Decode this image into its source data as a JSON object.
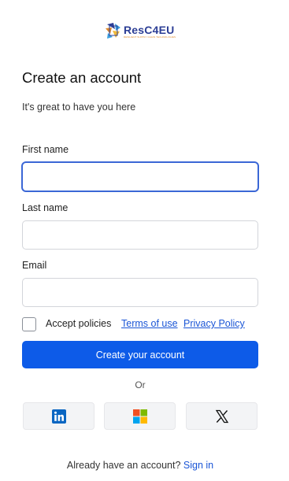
{
  "brand": {
    "name": "ResC4EU",
    "tagline": "RESILIENT SUPPLY CHAIN TECHNOLOGIES"
  },
  "header": {
    "title": "Create an account",
    "subtitle": "It's great to have you here"
  },
  "form": {
    "first_name": {
      "label": "First name",
      "value": "",
      "placeholder": ""
    },
    "last_name": {
      "label": "Last name",
      "value": "",
      "placeholder": ""
    },
    "email": {
      "label": "Email",
      "value": "",
      "placeholder": ""
    },
    "accept_label": "Accept policies",
    "terms_link": "Terms of use",
    "privacy_link": "Privacy Policy",
    "submit_label": "Create your account",
    "accept_checked": false
  },
  "divider_text": "Or",
  "social": [
    {
      "name": "linkedin-icon"
    },
    {
      "name": "microsoft-icon"
    },
    {
      "name": "x-icon"
    }
  ],
  "footer": {
    "prompt": "Already have an account?",
    "signin_label": "Sign in"
  },
  "colors": {
    "primary": "#0d5be8",
    "link": "#1a55d6",
    "focus_border": "#3b67d6",
    "linkedin": "#0a66c2"
  }
}
